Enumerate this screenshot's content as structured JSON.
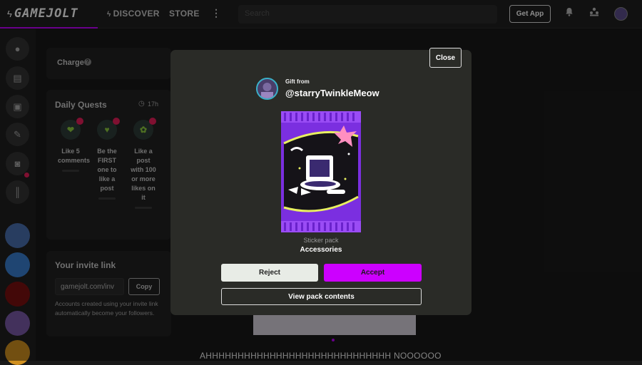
{
  "header": {
    "logo_text": "GAMEJOLT",
    "nav_discover": "DISCOVER",
    "nav_store": "STORE",
    "search_placeholder": "Search",
    "get_app_label": "Get App"
  },
  "sidebar": {
    "items": [
      {
        "icon": "pin-icon"
      },
      {
        "icon": "store-icon"
      },
      {
        "icon": "backpack-icon"
      },
      {
        "icon": "quest-icon"
      },
      {
        "icon": "chat-icon"
      },
      {
        "icon": "library-icon"
      }
    ],
    "avatars": [
      "avatar-1",
      "avatar-2",
      "avatar-3",
      "avatar-4",
      "avatar-5"
    ]
  },
  "charge": {
    "label": "Charge"
  },
  "daily_quests": {
    "title": "Daily Quests",
    "timer": "17h",
    "quests": [
      {
        "text": "Like 5 comments"
      },
      {
        "text": "Be the FIRST one to like a post"
      },
      {
        "text": "Like a post with 100 or more likes on it"
      }
    ]
  },
  "invite": {
    "title": "Your invite link",
    "link_value": "gamejolt.com/inv",
    "copy_label": "Copy",
    "description": "Accounts created using your invite link automatically become your followers."
  },
  "feed": {
    "post_text": "AHHHHHHHHHHHHHHHHHHHHHHHHHHHHH NOOOOOO"
  },
  "modal": {
    "close_label": "Close",
    "gift_from": "Gift from",
    "sender": "@starryTwinkleMeow",
    "pack_type": "Sticker pack",
    "pack_name": "Accessories",
    "reject_label": "Reject",
    "accept_label": "Accept",
    "view_contents_label": "View pack contents"
  },
  "colors": {
    "accent": "#cc00ff",
    "pack": "#8a3ef0",
    "badge": "#e81e5a"
  }
}
